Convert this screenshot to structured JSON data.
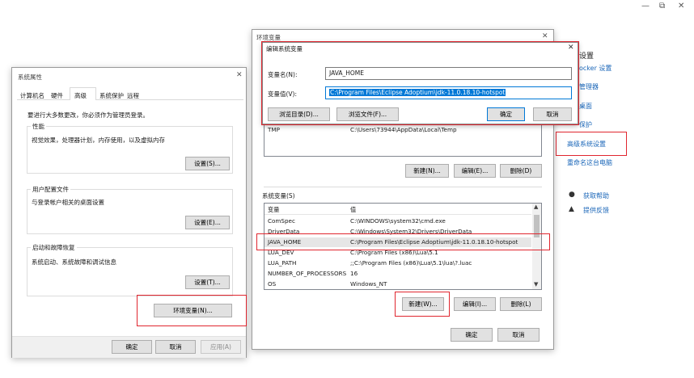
{
  "window_controls": {
    "minimize": "—",
    "restore": "⧉",
    "close": "✕"
  },
  "right_panel": {
    "items": [
      "设置",
      "ocker 设置",
      "管理器",
      "桌面",
      "保护",
      "高级系统设置",
      "重命名这台电脑"
    ],
    "help_label": "获取帮助",
    "feedback_label": "提供反馈"
  },
  "sysprops": {
    "title": "系统属性",
    "close": "✕",
    "tabs": [
      "计算机名",
      "硬件",
      "高级",
      "系统保护",
      "远程"
    ],
    "notice": "要进行大多数更改，你必须作为管理员登录。",
    "perf_title": "性能",
    "perf_desc": "视觉效果，处理器计划，内存使用，以及虚拟内存",
    "perf_btn": "设置(S)...",
    "profile_title": "用户配置文件",
    "profile_desc": "与登录帐户相关的桌面设置",
    "profile_btn": "设置(E)...",
    "startup_title": "启动和故障恢复",
    "startup_desc": "系统启动、系统故障和调试信息",
    "startup_btn": "设置(T)...",
    "env_btn": "环境变量(N)...",
    "ok": "确定",
    "cancel": "取消",
    "apply": "应用(A)"
  },
  "envvars": {
    "title": "环境变量",
    "close": "✕",
    "user_row_name": "TMP",
    "user_row_value": "C:\\Users\\73944\\AppData\\Local\\Temp",
    "user_new": "新建(N)...",
    "user_edit": "编辑(E)...",
    "user_delete": "删除(D)",
    "sys_title": "系统变量(S)",
    "col_var": "变量",
    "col_val": "值",
    "sys_rows": [
      {
        "name": "ComSpec",
        "value": "C:\\WINDOWS\\system32\\cmd.exe"
      },
      {
        "name": "DriverData",
        "value": "C:\\Windows\\System32\\Drivers\\DriverData"
      },
      {
        "name": "JAVA_HOME",
        "value": "C:\\Program Files\\Eclipse Adoptium\\jdk-11.0.18.10-hotspot"
      },
      {
        "name": "LUA_DEV",
        "value": "C:\\Program Files (x86)\\Lua\\5.1"
      },
      {
        "name": "LUA_PATH",
        "value": ";;C:\\Program Files (x86)\\Lua\\5.1\\lua\\?.luac"
      },
      {
        "name": "NUMBER_OF_PROCESSORS",
        "value": "16"
      },
      {
        "name": "OS",
        "value": "Windows_NT"
      }
    ],
    "sys_new": "新建(W)...",
    "sys_edit": "编辑(I)...",
    "sys_delete": "删除(L)",
    "ok": "确定",
    "cancel": "取消"
  },
  "editvar": {
    "title": "编辑系统变量",
    "close": "✕",
    "name_label": "变量名(N):",
    "name_value": "JAVA_HOME",
    "value_label": "变量值(V):",
    "value_value": "C:\\Program Files\\Eclipse Adoptium\\jdk-11.0.18.10-hotspot",
    "browse_dir": "浏览目录(D)...",
    "browse_file": "浏览文件(F)...",
    "ok": "确定",
    "cancel": "取消"
  }
}
